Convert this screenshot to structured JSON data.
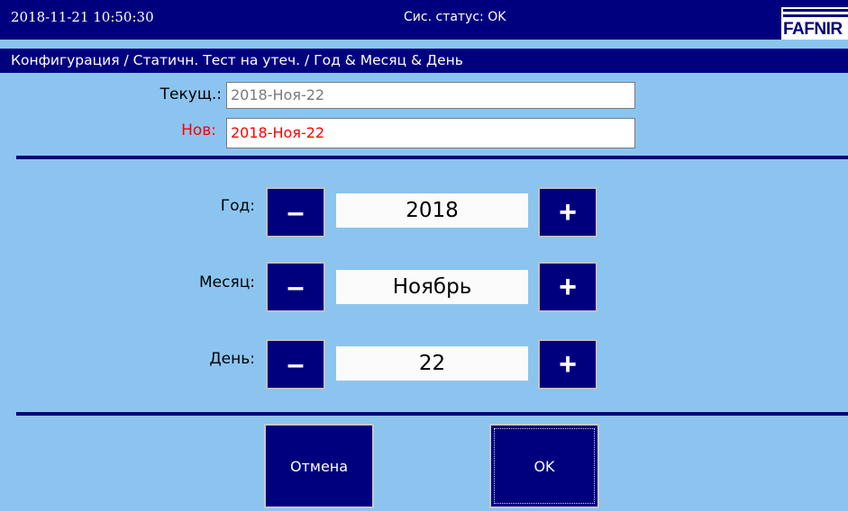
{
  "header": {
    "datetime": "2018-11-21  10:50:30",
    "status": "Сис. статус: OK",
    "logo_text": "FAFNIR"
  },
  "breadcrumb": "Конфигурация / Статичн. Тест на утеч. / Год & Месяц & День",
  "current": {
    "label": "Текущ.:",
    "value": "2018-Ноя-22",
    "color": "#7a7a7a"
  },
  "new": {
    "label": "Нов:",
    "value": "2018-Ноя-22",
    "color": "#ff0000"
  },
  "selectors": {
    "year": {
      "label": "Год:",
      "value": "2018"
    },
    "month": {
      "label": "Месяц:",
      "value": "Ноябрь"
    },
    "day": {
      "label": "День:",
      "value": "22"
    }
  },
  "buttons": {
    "minus": "–",
    "plus": "+",
    "cancel": "Отмена",
    "ok": "OK"
  },
  "colors": {
    "accent": "#00007e",
    "background": "#8cc4f0"
  }
}
